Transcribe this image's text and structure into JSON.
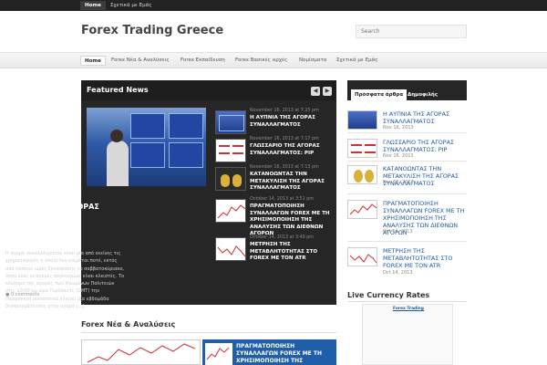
{
  "topbar": {
    "home": "Home",
    "about": "Σχετικά με Εμάς"
  },
  "site": {
    "title": "Forex Trading Greece"
  },
  "search": {
    "placeholder": "Search"
  },
  "nav": [
    {
      "label": "Home"
    },
    {
      "label": "Forex Νέα & Αναλύσεις"
    },
    {
      "label": "Forex Εκπαίδευση"
    },
    {
      "label": "Forex Βασικές αρχές"
    },
    {
      "label": "Νομίσματα"
    },
    {
      "label": "Σχετικά με Εμάς"
    }
  ],
  "featured": {
    "title": "Featured News",
    "prev_icon": "chevron-left-icon",
    "next_icon": "chevron-right-icon",
    "main": {
      "headline": "Η ΑΥΠΝΙΑ ΤΗΣ ΑΓΟΡΑΣ ΣΥΝΑΛΛΑΓΜΑΤΟΣ",
      "excerpt": "Η αγορά συναλλάγματος είναι μία από εκείνες τις χρηματαγορές η οποία δεν κοιμάται ποτέ, εκτός από κάποιες ώρες ξεκούρασης το σαββατοκύριακο, όπου όλες οι αγορές παγκοσμίως είναι κλειστές. Το κλείσιμο της αγοράς των Ηνωμένων Πολιτειών στις 10:00 μμ ώρα Γκρίνουιτς (GMT) την Παρασκευή ουσιαστικά κλείνει μία εβδομάδα διαπραγμάτευσης στην αγορά [...]",
      "comments": "0 comments"
    },
    "items": [
      {
        "date": "November 16, 2013 at 7:25 pm",
        "title": "Η ΑΥΠΝΙΑ ΤΗΣ ΑΓΟΡΑΣ ΣΥΝΑΛΛΑΓΜΑΤΟΣ"
      },
      {
        "date": "November 16, 2013 at 7:17 pm",
        "title": "ΓΛΩΣΣΑΡΙΟ ΤΗΣ ΑΓΟΡΑΣ ΣΥΝΑΛΛΑΓΜΑΤΟΣ: PIP"
      },
      {
        "date": "November 16, 2013 at 7:13 pm",
        "title": "ΚΑΤΑΝΟΩΝΤΑΣ ΤΗΝ ΜΕΤΑΚΥΛΙΣΗ ΤΗΣ ΑΓΟΡΑΣ ΣΥΝΑΛΛΑΓΜΑΤΟΣ"
      },
      {
        "date": "October 14, 2013 at 3:51 pm",
        "title": "ΠΡΑΓΜΑΤΟΠΟΙΗΣΗ ΣΥΝΑΛΛΑΓΩΝ FOREX ΜΕ ΤΗ ΧΡΗΣΙΜΟΠΟΙΗΣΗ ΤΗΣ ΑΝΑΛΥΣΗΣ ΤΩΝ ΔΙΕΘΝΩΝ ΑΓΟΡΩΝ"
      },
      {
        "date": "October 14, 2013 at 3:49 pm",
        "title": "ΜΕΤΡΗΣΗ ΤΗΣ ΜΕΤΑΒΛΗΤΟΤΗΤΑΣ ΣΤΟ FOREX ΜΕ ΤΟΝ ATR"
      }
    ]
  },
  "sidebar": {
    "tabs": [
      {
        "label": "Πρόσφατα άρθρα"
      },
      {
        "label": "Δημοφιλής"
      }
    ],
    "items": [
      {
        "title": "Η ΑΥΠΝΙΑ ΤΗΣ ΑΓΟΡΑΣ ΣΥΝΑΛΛΑΓΜΑΤΟΣ",
        "date": "Nov 16, 2013"
      },
      {
        "title": "ΓΛΩΣΣΑΡΙΟ ΤΗΣ ΑΓΟΡΑΣ ΣΥΝΑΛΛΑΓΜΑΤΟΣ: PIP",
        "date": "Nov 16, 2013"
      },
      {
        "title": "ΚΑΤΑΝΟΩΝΤΑΣ ΤΗΝ ΜΕΤΑΚΥΛΙΣΗ ΤΗΣ ΑΓΟΡΑΣ ΣΥΝΑΛΛΑΓΜΑΤΟΣ",
        "date": "Nov 16, 2013"
      },
      {
        "title": "ΠΡΑΓΜΑΤΟΠΟΙΗΣΗ ΣΥΝΑΛΛΑΓΩΝ FOREX ΜΕ ΤΗ ΧΡΗΣΙΜΟΠΟΙΗΣΗ ΤΗΣ ΑΝΑΛΥΣΗΣ ΤΩΝ ΔΙΕΘΝΩΝ ΑΓΟΡΩΝ",
        "date": "Oct 14, 2013"
      },
      {
        "title": "ΜΕΤΡΗΣΗ ΤΗΣ ΜΕΤΑΒΛΗΤΟΤΗΤΑΣ ΣΤΟ FOREX ΜΕ ΤΟΝ ATR",
        "date": "Oct 14, 2013"
      }
    ],
    "live_rates": {
      "title": "Live Currency Rates",
      "link": "Forex Trading"
    }
  },
  "news": {
    "title": "Forex Νέα & Αναλύσεις",
    "panel_title": "ΠΡΑΓΜΑΤΟΠΟΙΗΣΗ ΣΥΝΑΛΛΑΓΩΝ FOREX ΜΕ ΤΗ ΧΡΗΣΙΜΟΠΟΙΗΣΗ ΤΗΣ ΑΝΑΛΥΣΗΣ"
  }
}
